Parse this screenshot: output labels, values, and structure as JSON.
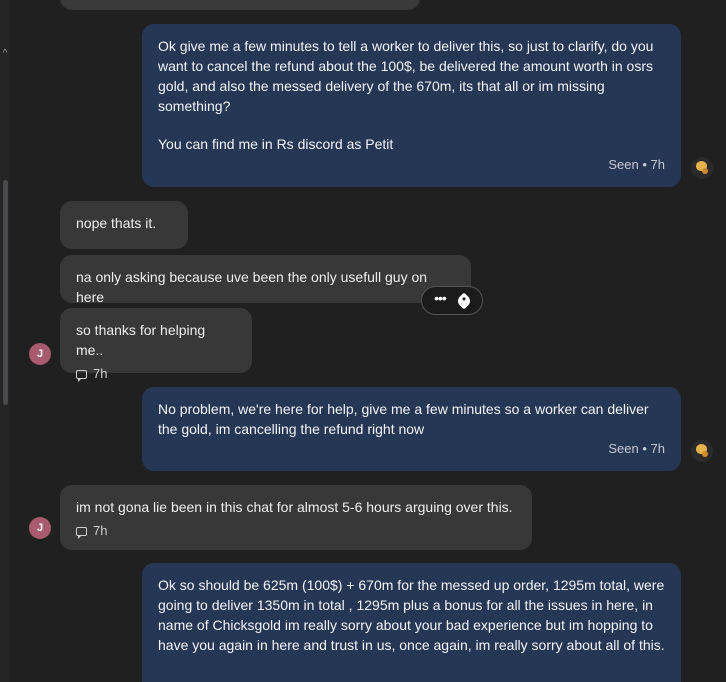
{
  "messages": {
    "m1": {
      "lines": [
        "Ok give me a few minutes to tell a worker to deliver this, so just to clarify, do you want to cancel the refund about the 100$, be delivered the amount worth in osrs gold, and also the messed delivery of the 670m, its that all or im missing something?",
        "You can find me in Rs discord as Petit"
      ],
      "status": "Seen • 7h"
    },
    "m2": {
      "text": "nope thats it."
    },
    "m3": {
      "text": "na only asking because uve been the only usefull guy on here"
    },
    "m4": {
      "text": "so thanks for helping me..",
      "time": "7h"
    },
    "m5": {
      "text": "No problem, we're here for help, give me a few minutes so a worker can deliver the gold, im cancelling the refund right now",
      "status": "Seen • 7h"
    },
    "m6": {
      "text": "im not gona lie been in this chat for almost 5-6 hours arguing over this.",
      "time": "7h"
    },
    "m7": {
      "text": "Ok so should be 625m (100$) + 670m for the messed up order, 1295m total, were going to deliver 1350m in total , 1295m plus a bonus for all the issues in here, in name of Chicksgold im really sorry about your bad experience but im hopping to have you again in here and trust in us, once again, im really sorry about all of this."
    }
  },
  "user_avatar_initial": "J",
  "hover_toolbar": {
    "more": "•••"
  },
  "colors": {
    "agent_bubble": "#263756",
    "user_bubble": "#393838",
    "avatar": "#a85a6e",
    "background": "#202021"
  },
  "icons": [
    "more-options-icon",
    "tag-icon",
    "chat-bubble-icon",
    "chevron-up-icon"
  ]
}
